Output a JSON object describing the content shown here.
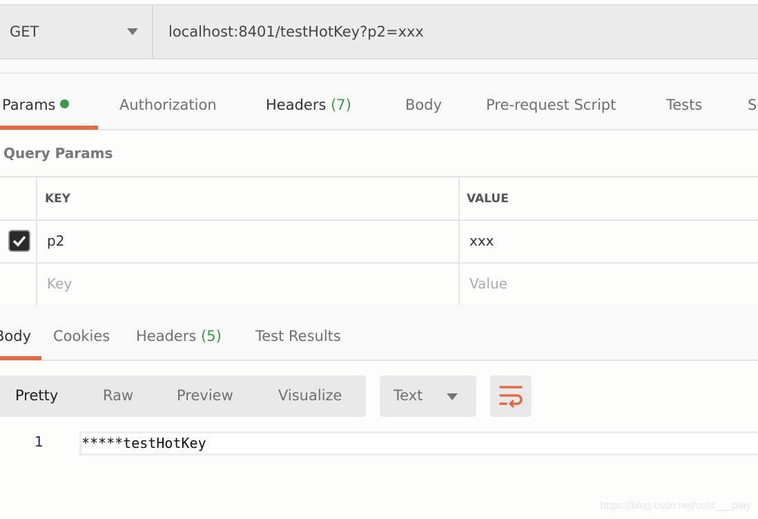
{
  "request": {
    "method": "GET",
    "url": "localhost:8401/testHotKey?p2=xxx"
  },
  "request_tabs": [
    {
      "label": "Params",
      "active": true,
      "indicator": "green-dot"
    },
    {
      "label": "Authorization"
    },
    {
      "label": "Headers",
      "count": "(7)"
    },
    {
      "label": "Body"
    },
    {
      "label": "Pre-request Script"
    },
    {
      "label": "Tests"
    },
    {
      "label": "Se"
    }
  ],
  "query_params": {
    "title": "Query Params",
    "columns": [
      "KEY",
      "VALUE"
    ],
    "rows": [
      {
        "checked": true,
        "key": "p2",
        "value": "xxx"
      }
    ],
    "placeholder": {
      "key": "Key",
      "value": "Value"
    }
  },
  "response_tabs": [
    {
      "label": "Body",
      "active": true
    },
    {
      "label": "Cookies"
    },
    {
      "label": "Headers",
      "count": "(5)"
    },
    {
      "label": "Test Results"
    }
  ],
  "view_modes": [
    "Pretty",
    "Raw",
    "Preview",
    "Visualize"
  ],
  "format_select": "Text",
  "wrap_icon": "wrap-lines-icon",
  "response_body": {
    "line_number": "1",
    "content": "*****testHotKey"
  },
  "watermark": "https://blog.csdn.net/cold___play",
  "colors": {
    "accent": "#e06c45",
    "count_green": "#3c9a4a"
  }
}
